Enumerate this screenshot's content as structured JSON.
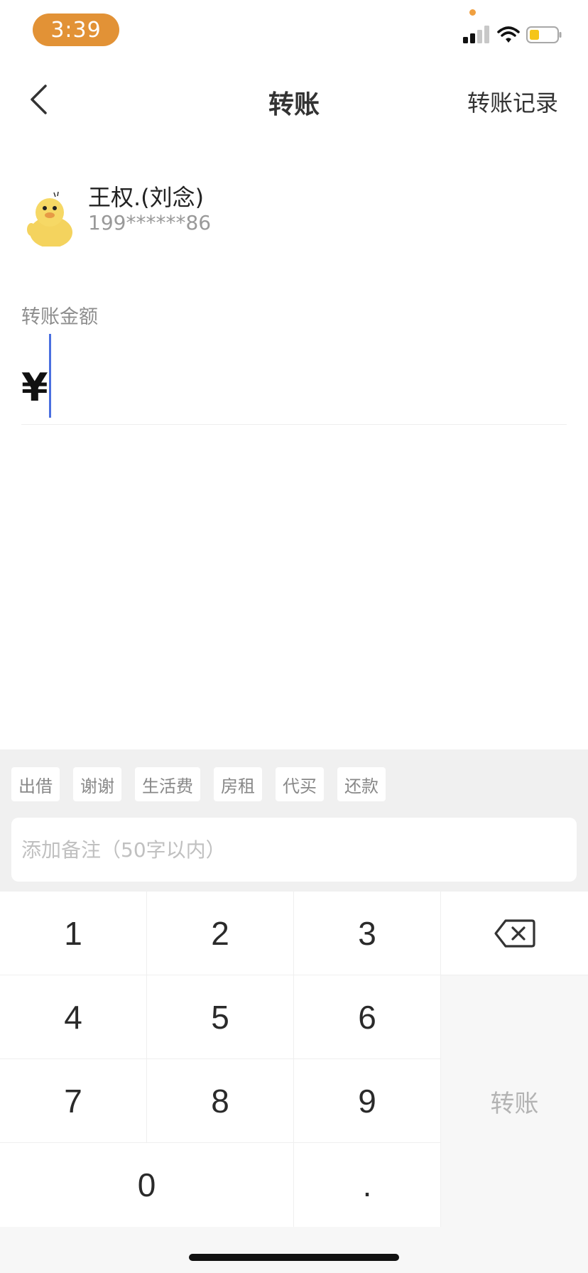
{
  "status_bar": {
    "time": "3:39",
    "icons": [
      "signal-icon",
      "wifi-icon",
      "battery-icon"
    ],
    "battery_color": "#f5c518",
    "time_pill_color": "#e29236"
  },
  "nav": {
    "title": "转账",
    "right_label": "转账记录",
    "back_icon": "chevron-left-icon"
  },
  "recipient": {
    "name": "王权.(刘念)",
    "phone": "199******86"
  },
  "amount": {
    "label": "转账金额",
    "currency_symbol": "¥",
    "value": ""
  },
  "remark": {
    "chips": [
      "出借",
      "谢谢",
      "生活费",
      "房租",
      "代买",
      "还款"
    ],
    "placeholder": "添加备注（50字以内）"
  },
  "keypad": {
    "keys": [
      "1",
      "2",
      "3",
      "4",
      "5",
      "6",
      "7",
      "8",
      "9",
      "0",
      "."
    ],
    "delete_icon": "backspace-icon",
    "transfer_label": "转账"
  }
}
